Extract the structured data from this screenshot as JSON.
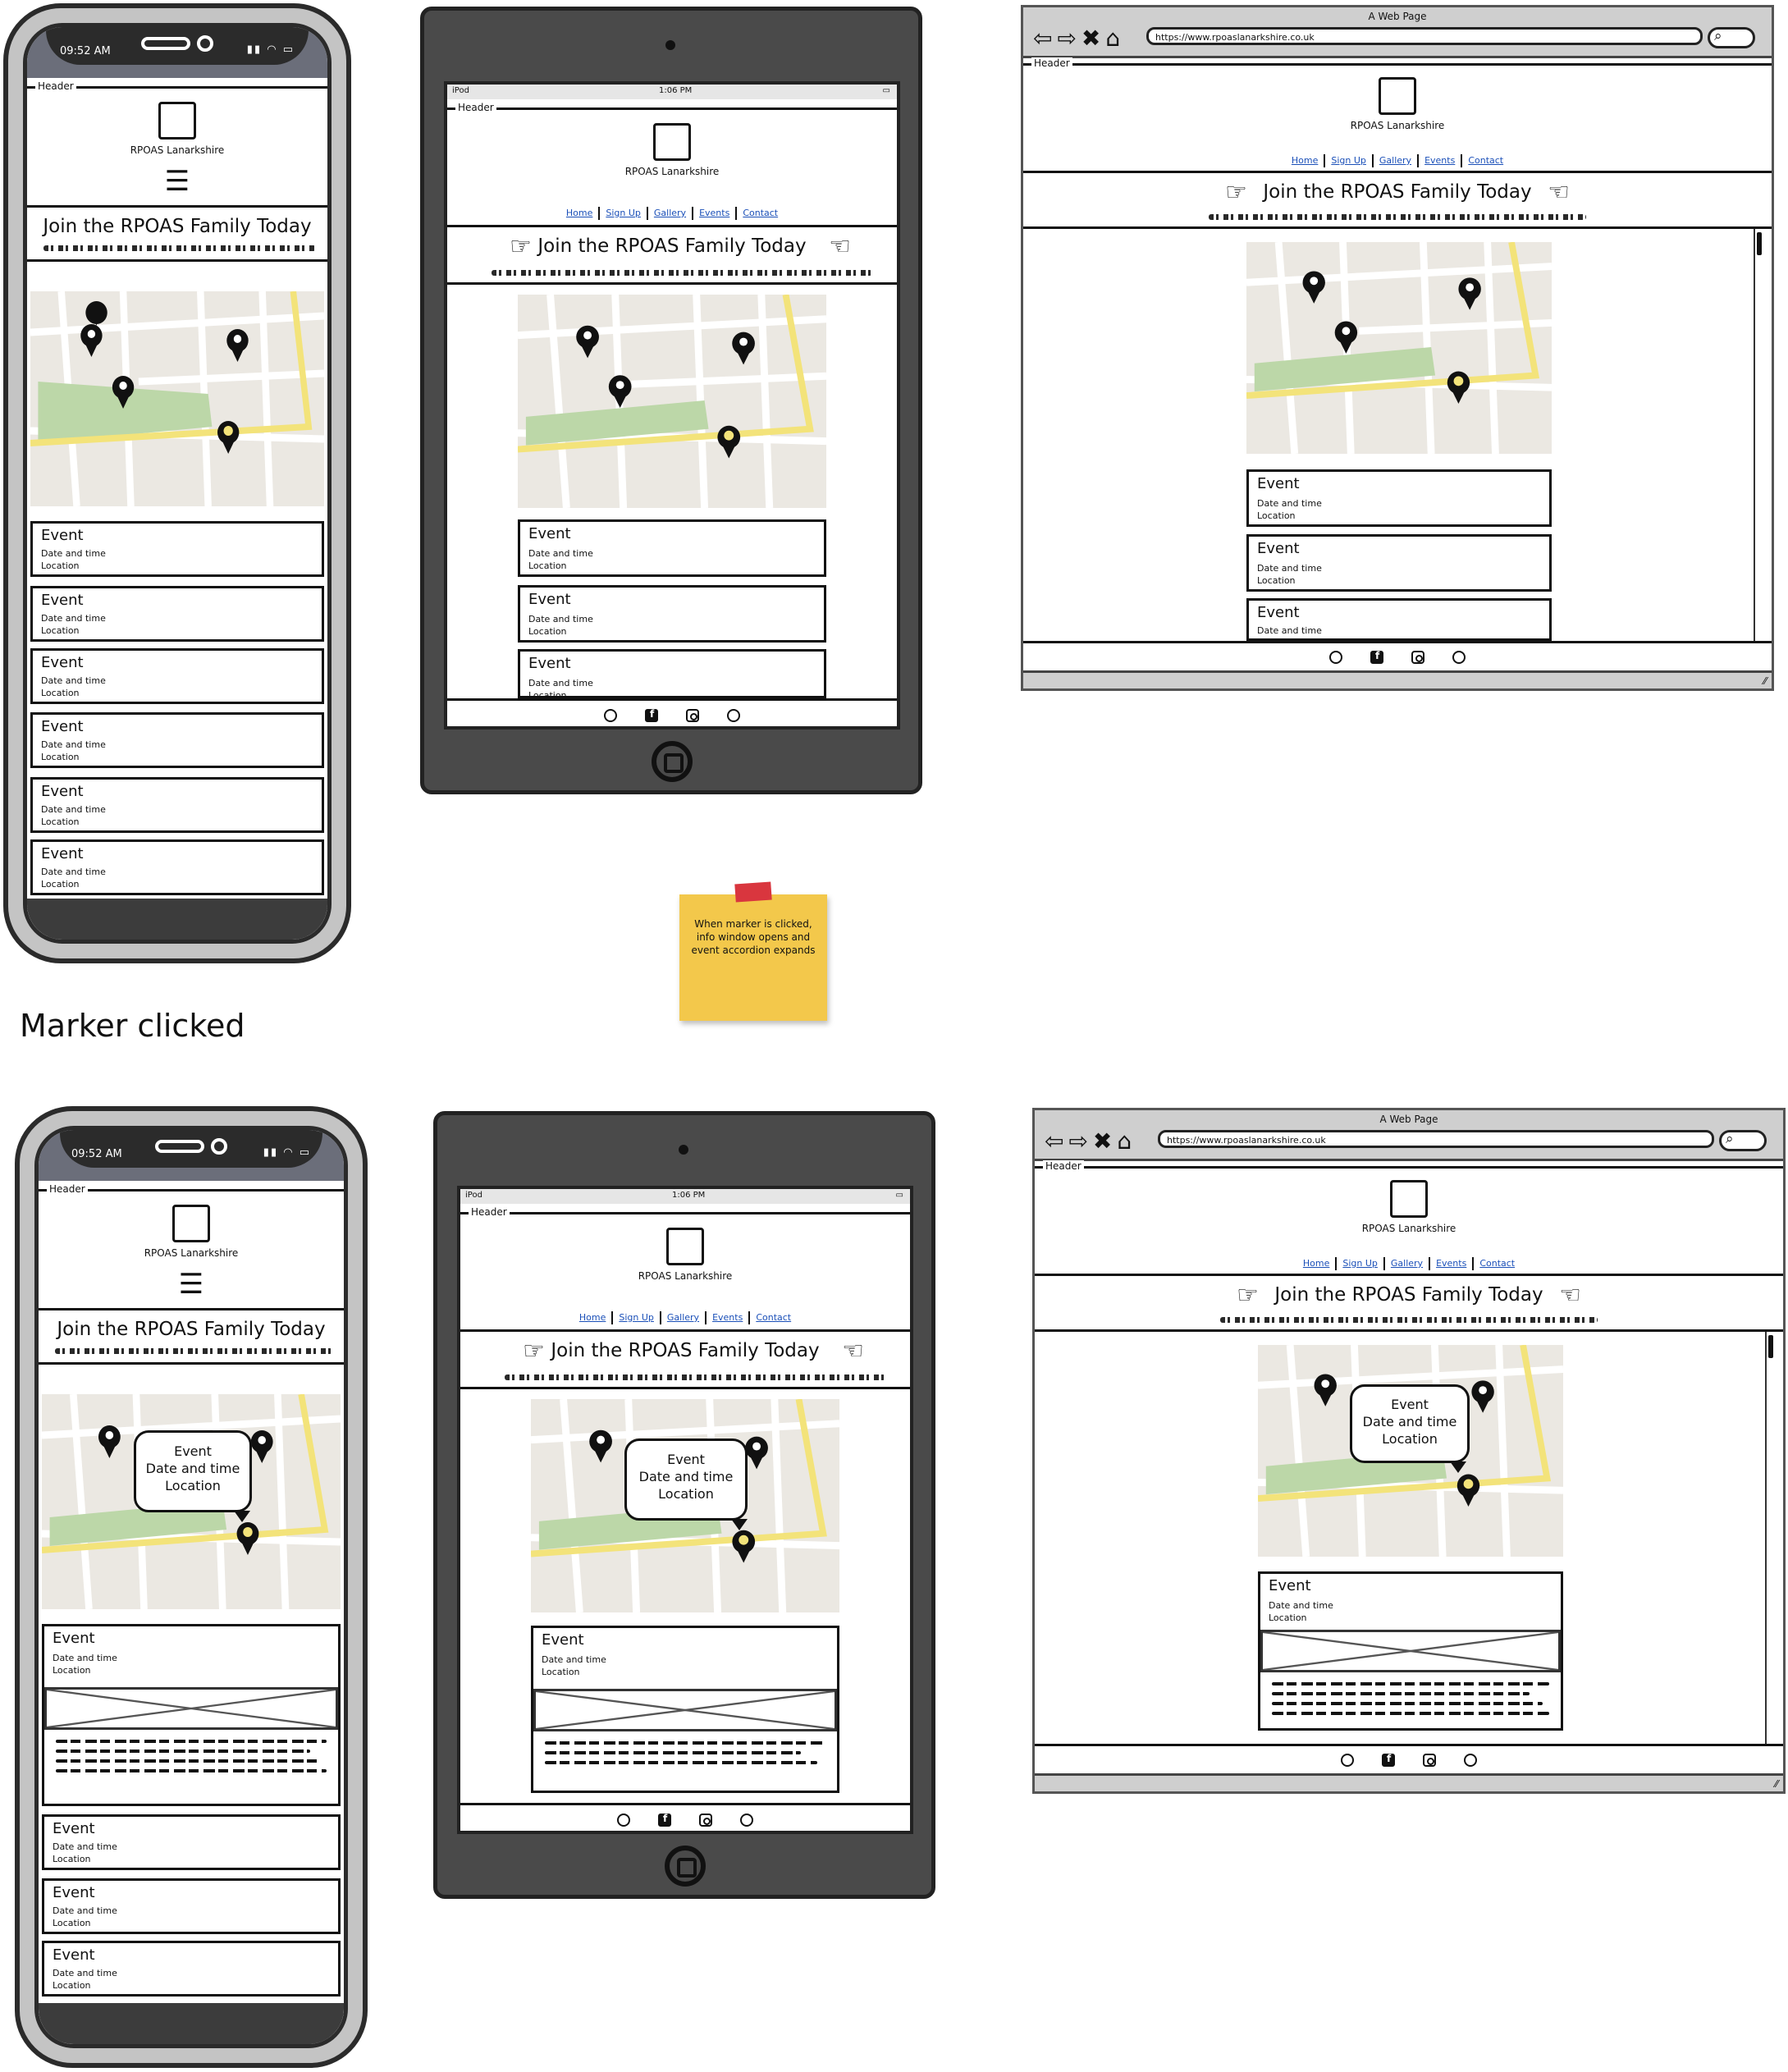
{
  "site": {
    "name": "RPOAS Lanarkshire",
    "header_label": "Header",
    "hero_title": "Join the RPOAS Family Today",
    "nav": [
      "Home",
      "Sign Up",
      "Gallery",
      "Events",
      "Contact"
    ]
  },
  "phone_status": {
    "time": "09:52 AM"
  },
  "tablet_status": {
    "carrier": "iPod",
    "time": "1:06 PM"
  },
  "browser": {
    "title": "A Web Page",
    "url": "https://www.rpoaslanarkshire.co.uk"
  },
  "event": {
    "title": "Event",
    "date": "Date and time",
    "location": "Location"
  },
  "bubble": [
    "Event",
    "Date and time",
    "Location"
  ],
  "section_marker_clicked": "Marker clicked",
  "sticky_note": "When marker is clicked, info window opens and event accordion expands",
  "colors": {
    "map_bg": "#ebe8e2",
    "park": "#bcd7a8",
    "road_yellow": "#f3e37a",
    "sticky": "#f3c84b",
    "link": "#1a4fb8"
  }
}
